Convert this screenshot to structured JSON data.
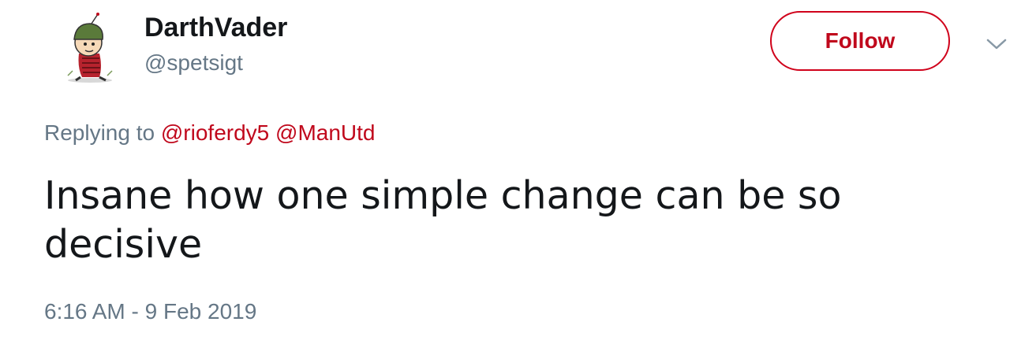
{
  "user": {
    "display_name": "DarthVader",
    "handle": "@spetsigt"
  },
  "follow": {
    "label": "Follow"
  },
  "reply": {
    "prefix": "Replying to",
    "mentions": [
      "@rioferdy5",
      "@ManUtd"
    ]
  },
  "tweet": {
    "text": "Insane how one simple change can be so decisive",
    "timestamp": "6:16 AM - 9 Feb 2019"
  },
  "colors": {
    "accent": "#c0081c",
    "muted": "#657786"
  },
  "icons": {
    "more": "chevron-down-icon"
  }
}
